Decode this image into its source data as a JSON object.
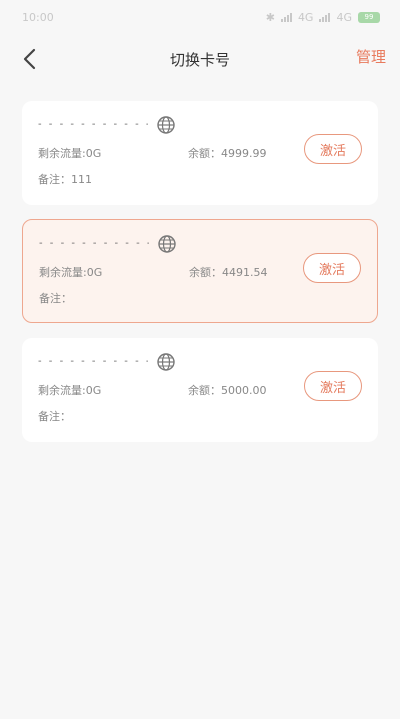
{
  "status_bar": {
    "time": "10:00",
    "network_1": "4G",
    "network_2": "4G",
    "battery": "99"
  },
  "header": {
    "title": "切换卡号",
    "manage_label": "管理"
  },
  "cards": [
    {
      "number_masked": "- - - - - - - - - - - -",
      "flow": "剩余流量:0G",
      "balance": "余额：4999.99",
      "note": "备注：111",
      "action_label": "激活",
      "selected": false
    },
    {
      "number_masked": "- - - - - - - - - - - -",
      "flow": "剩余流量:0G",
      "balance": "余额：4491.54",
      "note": "备注：",
      "action_label": "激活",
      "selected": true
    },
    {
      "number_masked": "- - - - - - - - - - - -",
      "flow": "剩余流量:0G",
      "balance": "余额：5000.00",
      "note": "备注：",
      "action_label": "激活",
      "selected": false
    }
  ],
  "colors": {
    "accent": "#e87a5d",
    "selected_bg": "#fdf3ee",
    "selected_border": "#eea78f"
  }
}
